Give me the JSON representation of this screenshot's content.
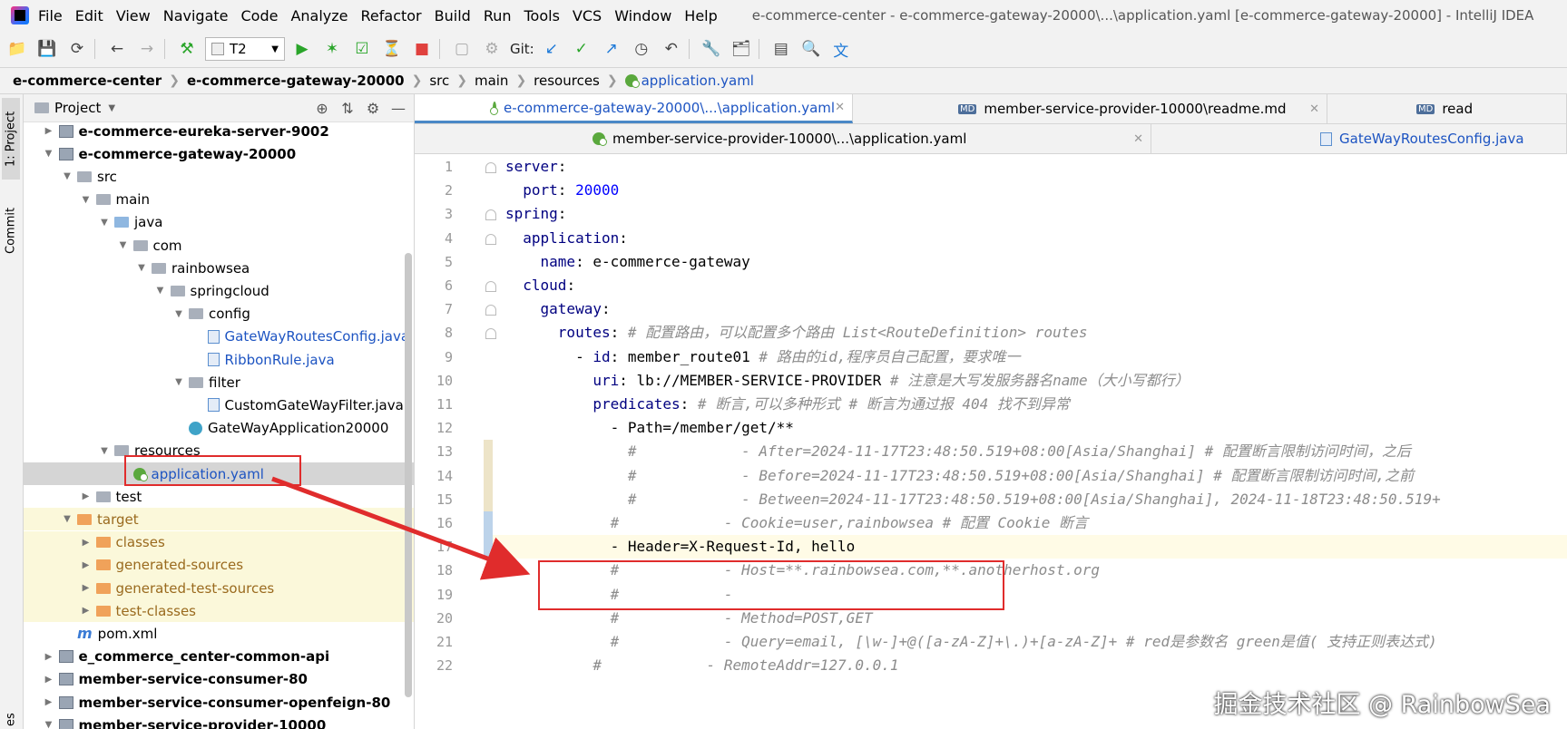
{
  "menubar": {
    "items": [
      "File",
      "Edit",
      "View",
      "Navigate",
      "Code",
      "Analyze",
      "Refactor",
      "Build",
      "Run",
      "Tools",
      "VCS",
      "Window",
      "Help"
    ],
    "window_title": "e-commerce-center - e-commerce-gateway-20000\\...\\application.yaml [e-commerce-gateway-20000] - IntelliJ IDEA"
  },
  "toolbar": {
    "run_config": "T2",
    "git_label": "Git:"
  },
  "breadcrumb": [
    "e-commerce-center",
    "e-commerce-gateway-20000",
    "src",
    "main",
    "resources",
    "application.yaml"
  ],
  "side_tabs": {
    "project": "1: Project",
    "commit": "Commit",
    "bottom": "es"
  },
  "project_panel": {
    "title": "Project",
    "tree": [
      {
        "label": "e-commerce-eureka-server-9002",
        "depth": 1,
        "icon": "module",
        "caret": "right",
        "bold": true
      },
      {
        "label": "e-commerce-gateway-20000",
        "depth": 1,
        "icon": "module",
        "caret": "down",
        "bold": true
      },
      {
        "label": "src",
        "depth": 2,
        "icon": "folder",
        "caret": "down"
      },
      {
        "label": "main",
        "depth": 3,
        "icon": "folder",
        "caret": "down"
      },
      {
        "label": "java",
        "depth": 4,
        "icon": "folder-src",
        "caret": "down"
      },
      {
        "label": "com",
        "depth": 5,
        "icon": "folder",
        "caret": "down"
      },
      {
        "label": "rainbowsea",
        "depth": 6,
        "icon": "folder",
        "caret": "down"
      },
      {
        "label": "springcloud",
        "depth": 7,
        "icon": "folder",
        "caret": "down"
      },
      {
        "label": "config",
        "depth": 8,
        "icon": "folder",
        "caret": "down"
      },
      {
        "label": "GateWayRoutesConfig.java",
        "depth": 9,
        "icon": "java",
        "caret": "",
        "blue": true
      },
      {
        "label": "RibbonRule.java",
        "depth": 9,
        "icon": "java",
        "caret": "",
        "blue": true
      },
      {
        "label": "filter",
        "depth": 8,
        "icon": "folder",
        "caret": "down"
      },
      {
        "label": "CustomGateWayFilter.java",
        "depth": 9,
        "icon": "java",
        "caret": ""
      },
      {
        "label": "GateWayApplication20000",
        "depth": 8,
        "icon": "class",
        "caret": ""
      },
      {
        "label": "resources",
        "depth": 4,
        "icon": "folder",
        "caret": "down"
      },
      {
        "label": "application.yaml",
        "depth": 5,
        "icon": "yaml",
        "caret": "",
        "selected": true,
        "blue": true
      },
      {
        "label": "test",
        "depth": 3,
        "icon": "folder",
        "caret": "right"
      },
      {
        "label": "target",
        "depth": 2,
        "icon": "folder-orange",
        "caret": "down",
        "excluded": true
      },
      {
        "label": "classes",
        "depth": 3,
        "icon": "folder-orange",
        "caret": "right",
        "excluded": true
      },
      {
        "label": "generated-sources",
        "depth": 3,
        "icon": "folder-orange",
        "caret": "right",
        "excluded": true
      },
      {
        "label": "generated-test-sources",
        "depth": 3,
        "icon": "folder-orange",
        "caret": "right",
        "excluded": true
      },
      {
        "label": "test-classes",
        "depth": 3,
        "icon": "folder-orange",
        "caret": "right",
        "excluded": true
      },
      {
        "label": "pom.xml",
        "depth": 2,
        "icon": "maven",
        "caret": ""
      },
      {
        "label": "e_commerce_center-common-api",
        "depth": 1,
        "icon": "module",
        "caret": "right",
        "bold": true
      },
      {
        "label": "member-service-consumer-80",
        "depth": 1,
        "icon": "module",
        "caret": "right",
        "bold": true
      },
      {
        "label": "member-service-consumer-openfeign-80",
        "depth": 1,
        "icon": "module",
        "caret": "right",
        "bold": true
      },
      {
        "label": "member-service-provider-10000",
        "depth": 1,
        "icon": "module",
        "caret": "down",
        "bold": true
      }
    ]
  },
  "tabs_row1": [
    {
      "label": "e-commerce-gateway-20000\\...\\application.yaml",
      "icon": "yaml",
      "active": true
    },
    {
      "label": "member-service-provider-10000\\readme.md",
      "icon": "md"
    },
    {
      "label": "read",
      "icon": "md"
    }
  ],
  "tabs_row2": [
    {
      "label": "member-service-provider-10000\\...\\application.yaml",
      "icon": "yaml"
    },
    {
      "label": "GateWayRoutesConfig.java",
      "icon": "java"
    }
  ],
  "editor": {
    "lines": [
      {
        "n": 1,
        "parts": [
          [
            "k",
            "server"
          ],
          [
            "v",
            ":"
          ]
        ]
      },
      {
        "n": 2,
        "parts": [
          [
            "v",
            "  "
          ],
          [
            "k",
            "port"
          ],
          [
            "v",
            ": "
          ],
          [
            "num",
            "20000"
          ]
        ]
      },
      {
        "n": 3,
        "parts": [
          [
            "k",
            "spring"
          ],
          [
            "v",
            ":"
          ]
        ]
      },
      {
        "n": 4,
        "parts": [
          [
            "v",
            "  "
          ],
          [
            "k",
            "application"
          ],
          [
            "v",
            ":"
          ]
        ]
      },
      {
        "n": 5,
        "parts": [
          [
            "v",
            "    "
          ],
          [
            "k",
            "name"
          ],
          [
            "v",
            ": e-commerce-gateway"
          ]
        ]
      },
      {
        "n": 6,
        "parts": [
          [
            "v",
            "  "
          ],
          [
            "k",
            "cloud"
          ],
          [
            "v",
            ":"
          ]
        ]
      },
      {
        "n": 7,
        "parts": [
          [
            "v",
            "    "
          ],
          [
            "k",
            "gateway"
          ],
          [
            "v",
            ":"
          ]
        ]
      },
      {
        "n": 8,
        "parts": [
          [
            "v",
            "      "
          ],
          [
            "k",
            "routes"
          ],
          [
            "v",
            ": "
          ],
          [
            "cm",
            "# 配置路由，可以配置多个路由 List<RouteDefinition> routes"
          ]
        ]
      },
      {
        "n": 9,
        "parts": [
          [
            "v",
            "        - "
          ],
          [
            "k",
            "id"
          ],
          [
            "v",
            ": member_route01 "
          ],
          [
            "cm",
            "# 路由的id,程序员自己配置，要求唯一"
          ]
        ]
      },
      {
        "n": 10,
        "parts": [
          [
            "v",
            "          "
          ],
          [
            "k",
            "uri"
          ],
          [
            "v",
            ": lb://MEMBER-SERVICE-PROVIDER "
          ],
          [
            "cm",
            "# 注意是大写发服务器名name（大小写都行）"
          ]
        ]
      },
      {
        "n": 11,
        "parts": [
          [
            "v",
            "          "
          ],
          [
            "k",
            "predicates"
          ],
          [
            "v",
            ": "
          ],
          [
            "cm",
            "# 断言,可以多种形式 # 断言为通过报 404 找不到异常"
          ]
        ]
      },
      {
        "n": 12,
        "parts": [
          [
            "v",
            "            - Path=/member/get/**"
          ]
        ]
      },
      {
        "n": 13,
        "parts": [
          [
            "v",
            "              "
          ],
          [
            "cm",
            "#            - After=2024-11-17T23:48:50.519+08:00[Asia/Shanghai] # 配置断言限制访问时间，之后"
          ]
        ]
      },
      {
        "n": 14,
        "parts": [
          [
            "v",
            "              "
          ],
          [
            "cm",
            "#            - Before=2024-11-17T23:48:50.519+08:00[Asia/Shanghai] # 配置断言限制访问时间,之前"
          ]
        ]
      },
      {
        "n": 15,
        "parts": [
          [
            "v",
            "              "
          ],
          [
            "cm",
            "#            - Between=2024-11-17T23:48:50.519+08:00[Asia/Shanghai], 2024-11-18T23:48:50.519+"
          ]
        ]
      },
      {
        "n": 16,
        "parts": [
          [
            "v",
            "            "
          ],
          [
            "cm",
            "#            - Cookie=user,rainbowsea # 配置 Cookie 断言"
          ]
        ]
      },
      {
        "n": 17,
        "parts": [
          [
            "v",
            "            - Header=X-Request-Id, hello"
          ]
        ],
        "current": true
      },
      {
        "n": 18,
        "parts": [
          [
            "v",
            "            "
          ],
          [
            "cm",
            "#            - Host=**.rainbowsea.com,**.anotherhost.org"
          ]
        ]
      },
      {
        "n": 19,
        "parts": [
          [
            "v",
            "            "
          ],
          [
            "cm",
            "#            -"
          ]
        ]
      },
      {
        "n": 20,
        "parts": [
          [
            "v",
            "            "
          ],
          [
            "cm",
            "#            - Method=POST,GET"
          ]
        ]
      },
      {
        "n": 21,
        "parts": [
          [
            "v",
            "            "
          ],
          [
            "cm",
            "#            - Query=email, [\\w-]+@([a-zA-Z]+\\.)+[a-zA-Z]+ # red是参数名 green是值( 支持正则表达式)"
          ]
        ]
      },
      {
        "n": 22,
        "parts": [
          [
            "v",
            "          "
          ],
          [
            "cm",
            "#            - RemoteAddr=127.0.0.1"
          ]
        ]
      }
    ]
  },
  "watermark": "掘金技术社区 @ RainbowSea",
  "colors": {
    "key": "#000080",
    "number": "#0000ff",
    "comment": "#8c8c8c",
    "annotation": "#e02c2c",
    "selection": "#d5d5d5"
  }
}
